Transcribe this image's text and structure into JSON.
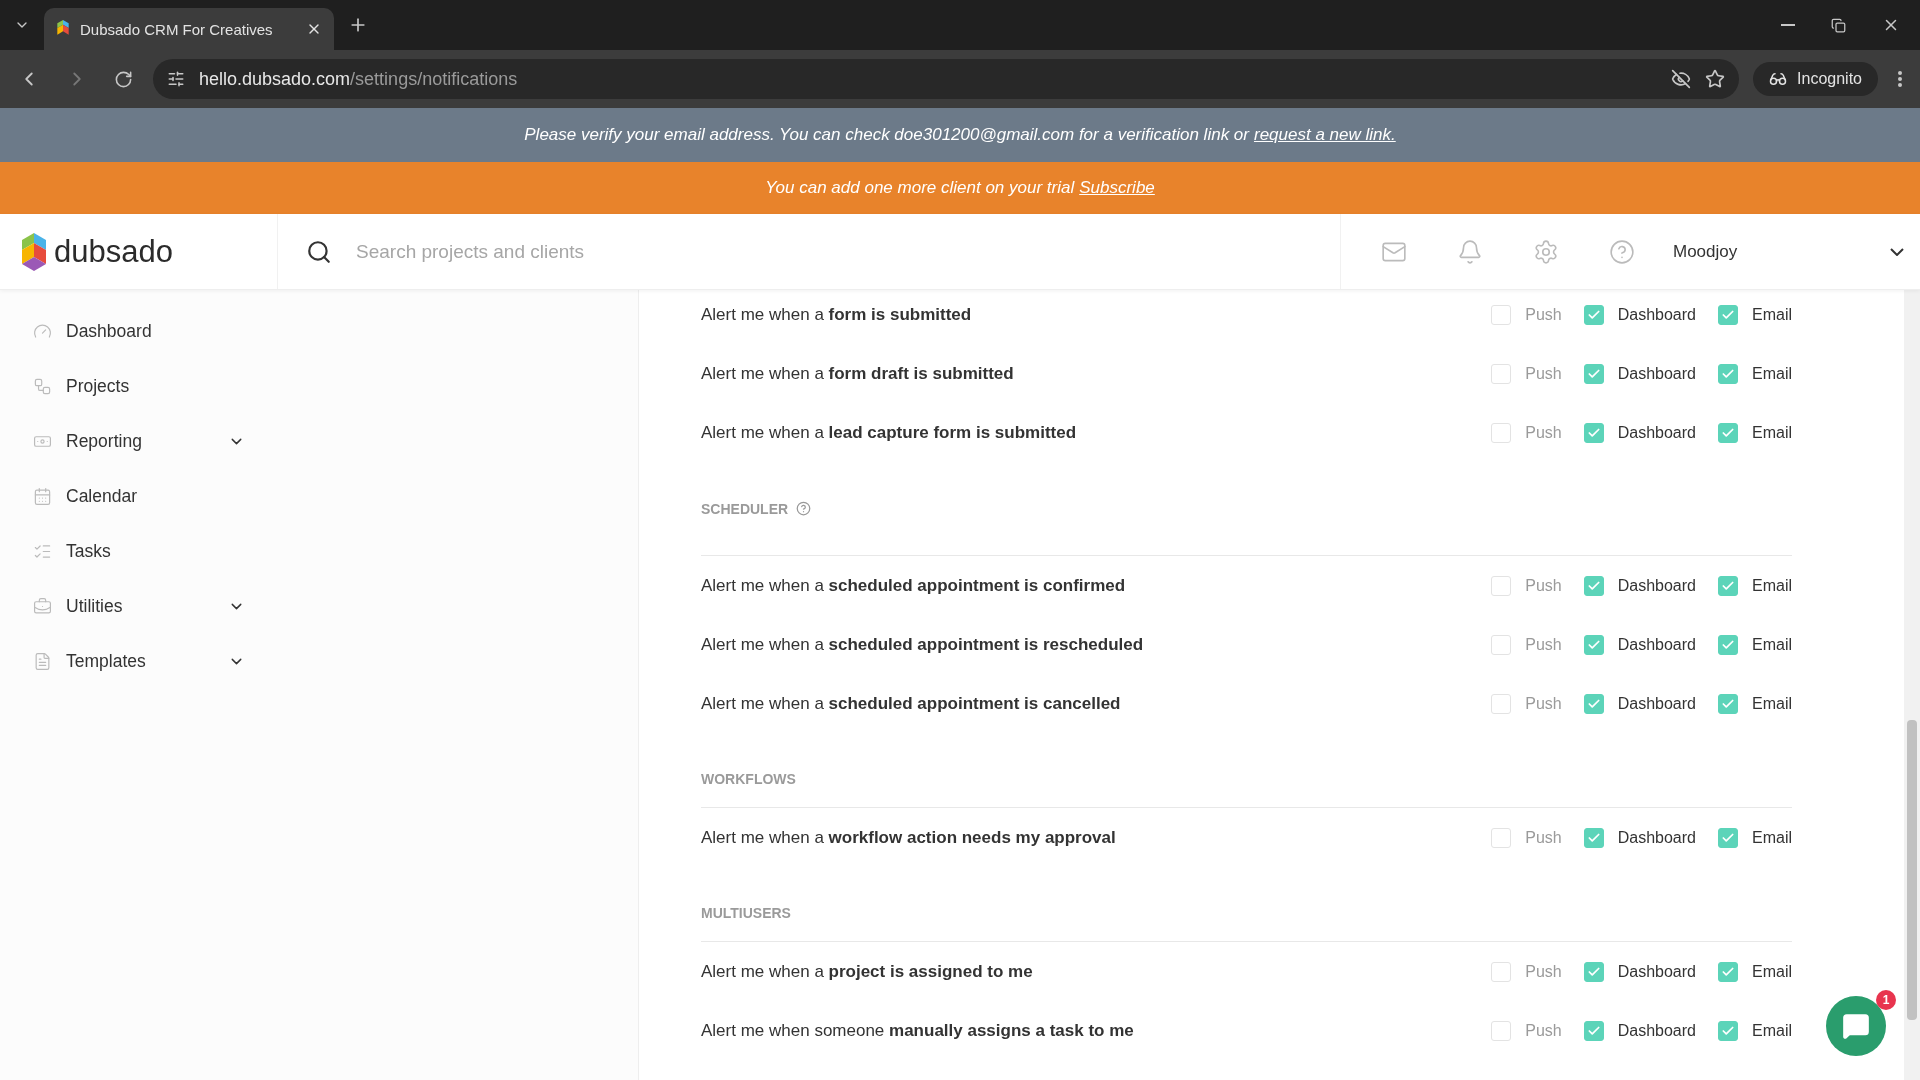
{
  "browser": {
    "tab_title": "Dubsado CRM For Creatives",
    "url_host": "hello.dubsado.com",
    "url_path": "/settings/notifications",
    "profile": "Incognito"
  },
  "verify_banner": {
    "text": "Please verify your email address. You can check doe301200@gmail.com for a verification link or",
    "link": "request a new link."
  },
  "trial_banner": {
    "text": "You can add one more client on your trial",
    "link": "Subscribe"
  },
  "header": {
    "logo": "dubsado",
    "search": {
      "placeholder": "Search projects and clients"
    },
    "user": "Moodjoy"
  },
  "sidebar": {
    "items": [
      {
        "label": "Dashboard",
        "expandable": false
      },
      {
        "label": "Projects",
        "expandable": false
      },
      {
        "label": "Reporting",
        "expandable": true
      },
      {
        "label": "Calendar",
        "expandable": false
      },
      {
        "label": "Tasks",
        "expandable": false
      },
      {
        "label": "Utilities",
        "expandable": true
      },
      {
        "label": "Templates",
        "expandable": true
      }
    ]
  },
  "sections": [
    {
      "rows": [
        {
          "text": "Alert me when a **form is submitted**",
          "options": [
            {
              "label": "Push",
              "checked": false,
              "disabled": true
            },
            {
              "label": "Dashboard",
              "checked": true,
              "disabled": false
            },
            {
              "label": "Email",
              "checked": true,
              "disabled": false
            }
          ]
        },
        {
          "text": "Alert me when a **form draft is submitted**",
          "options": [
            {
              "label": "Push",
              "checked": false,
              "disabled": true
            },
            {
              "label": "Dashboard",
              "checked": true,
              "disabled": false
            },
            {
              "label": "Email",
              "checked": true,
              "disabled": false
            }
          ]
        },
        {
          "text": "Alert me when a **lead capture form is submitted**",
          "options": [
            {
              "label": "Push",
              "checked": false,
              "disabled": true
            },
            {
              "label": "Dashboard",
              "checked": true,
              "disabled": false
            },
            {
              "label": "Email",
              "checked": true,
              "disabled": false
            }
          ]
        }
      ]
    },
    {
      "title": "SCHEDULER",
      "help": true,
      "rows": [
        {
          "text": "Alert me when a **scheduled appointment is confirmed**",
          "options": [
            {
              "label": "Push",
              "checked": false,
              "disabled": true
            },
            {
              "label": "Dashboard",
              "checked": true,
              "disabled": false
            },
            {
              "label": "Email",
              "checked": true,
              "disabled": false
            }
          ]
        },
        {
          "text": "Alert me when a **scheduled appointment is rescheduled**",
          "options": [
            {
              "label": "Push",
              "checked": false,
              "disabled": true
            },
            {
              "label": "Dashboard",
              "checked": true,
              "disabled": false
            },
            {
              "label": "Email",
              "checked": true,
              "disabled": false
            }
          ]
        },
        {
          "text": "Alert me when a **scheduled appointment is cancelled**",
          "options": [
            {
              "label": "Push",
              "checked": false,
              "disabled": true
            },
            {
              "label": "Dashboard",
              "checked": true,
              "disabled": false
            },
            {
              "label": "Email",
              "checked": true,
              "disabled": false
            }
          ]
        }
      ]
    },
    {
      "title": "WORKFLOWS",
      "help": false,
      "rows": [
        {
          "text": "Alert me when a **workflow action needs my approval**",
          "options": [
            {
              "label": "Push",
              "checked": false,
              "disabled": true
            },
            {
              "label": "Dashboard",
              "checked": true,
              "disabled": false
            },
            {
              "label": "Email",
              "checked": true,
              "disabled": false
            }
          ]
        }
      ]
    },
    {
      "title": "MULTIUSERS",
      "help": false,
      "rows": [
        {
          "text": "Alert me when a **project is assigned to me**",
          "options": [
            {
              "label": "Push",
              "checked": false,
              "disabled": true
            },
            {
              "label": "Dashboard",
              "checked": true,
              "disabled": false
            },
            {
              "label": "Email",
              "checked": true,
              "disabled": false
            }
          ]
        },
        {
          "text": "Alert me when someone **manually assigns a task to me**",
          "options": [
            {
              "label": "Push",
              "checked": false,
              "disabled": true
            },
            {
              "label": "Dashboard",
              "checked": true,
              "disabled": false
            },
            {
              "label": "Email",
              "checked": true,
              "disabled": false
            }
          ]
        }
      ]
    }
  ],
  "chat": {
    "badge": "1"
  }
}
